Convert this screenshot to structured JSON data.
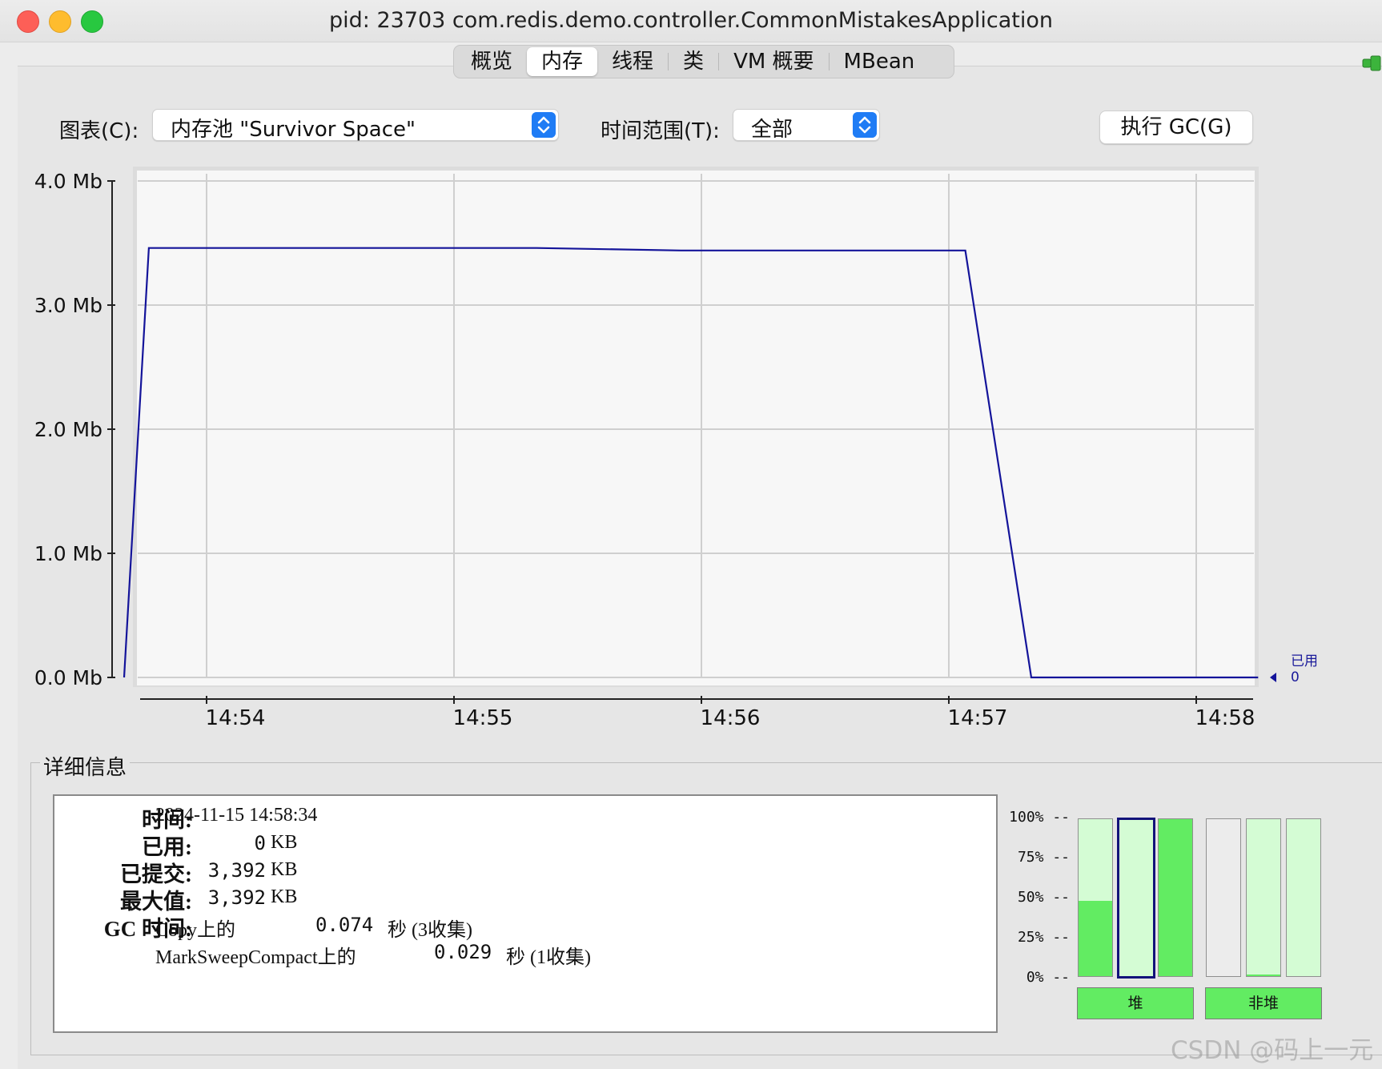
{
  "window": {
    "title": "pid: 23703 com.redis.demo.controller.CommonMistakesApplication"
  },
  "tabs": [
    {
      "label": "概览"
    },
    {
      "label": "内存",
      "active": true
    },
    {
      "label": "线程"
    },
    {
      "label": "类"
    },
    {
      "label": "VM 概要"
    },
    {
      "label": "MBean"
    }
  ],
  "toolbar": {
    "chart_label": "图表(C):",
    "chart_value": "内存池 \"Survivor Space\"",
    "range_label": "时间范围(T):",
    "range_value": "全部",
    "gc_button": "执行 GC(G)"
  },
  "chart_data": {
    "type": "line",
    "y_ticks": [
      "0.0 Mb",
      "1.0 Mb",
      "2.0 Mb",
      "3.0 Mb",
      "4.0 Mb"
    ],
    "x_ticks": [
      "14:54",
      "14:55",
      "14:56",
      "14:57",
      "14:58"
    ],
    "ylim": [
      0,
      4.0
    ],
    "y_unit": "Mb",
    "grid": true,
    "series": [
      {
        "name": "已用",
        "color": "#14149a",
        "points": [
          [
            "14:53:40",
            0.0
          ],
          [
            "14:53:46",
            3.46
          ],
          [
            "14:55:20",
            3.46
          ],
          [
            "14:55:55",
            3.44
          ],
          [
            "14:56:50",
            3.44
          ],
          [
            "14:57:04",
            3.44
          ],
          [
            "14:57:20",
            0.0
          ],
          [
            "14:58:15",
            0.0
          ]
        ]
      }
    ],
    "legend": {
      "label": "已用",
      "value": "0"
    }
  },
  "details": {
    "title": "详细信息",
    "time_label": "时间:",
    "time_value": "2024-11-15 14:58:34",
    "used_label": "已用:",
    "used_num": "0",
    "used_unit": "KB",
    "committed_label": "已提交:",
    "committed_num": "3,392",
    "committed_unit": "KB",
    "max_label": "最大值:",
    "max_num": "3,392",
    "max_unit": "KB",
    "gc_label": "GC 时间:",
    "gc1_name": "Copy上的",
    "gc1_secs": "0.074",
    "gc1_unit": "秒",
    "gc1_count": "(3收集)",
    "gc2_name": "MarkSweepCompact上的",
    "gc2_secs": "0.029",
    "gc2_unit": "秒",
    "gc2_count": "(1收集)"
  },
  "pools": {
    "axis": [
      "100% --",
      "75% --",
      "50% --",
      "25% --",
      "0% --"
    ],
    "heap_bars": [
      0.48,
      0.0,
      1.0
    ],
    "nonheap_bars": [
      0.0,
      0.01,
      0.0
    ],
    "heap_label": "堆",
    "nonheap_label": "非堆"
  },
  "watermark": "CSDN @码上一元"
}
